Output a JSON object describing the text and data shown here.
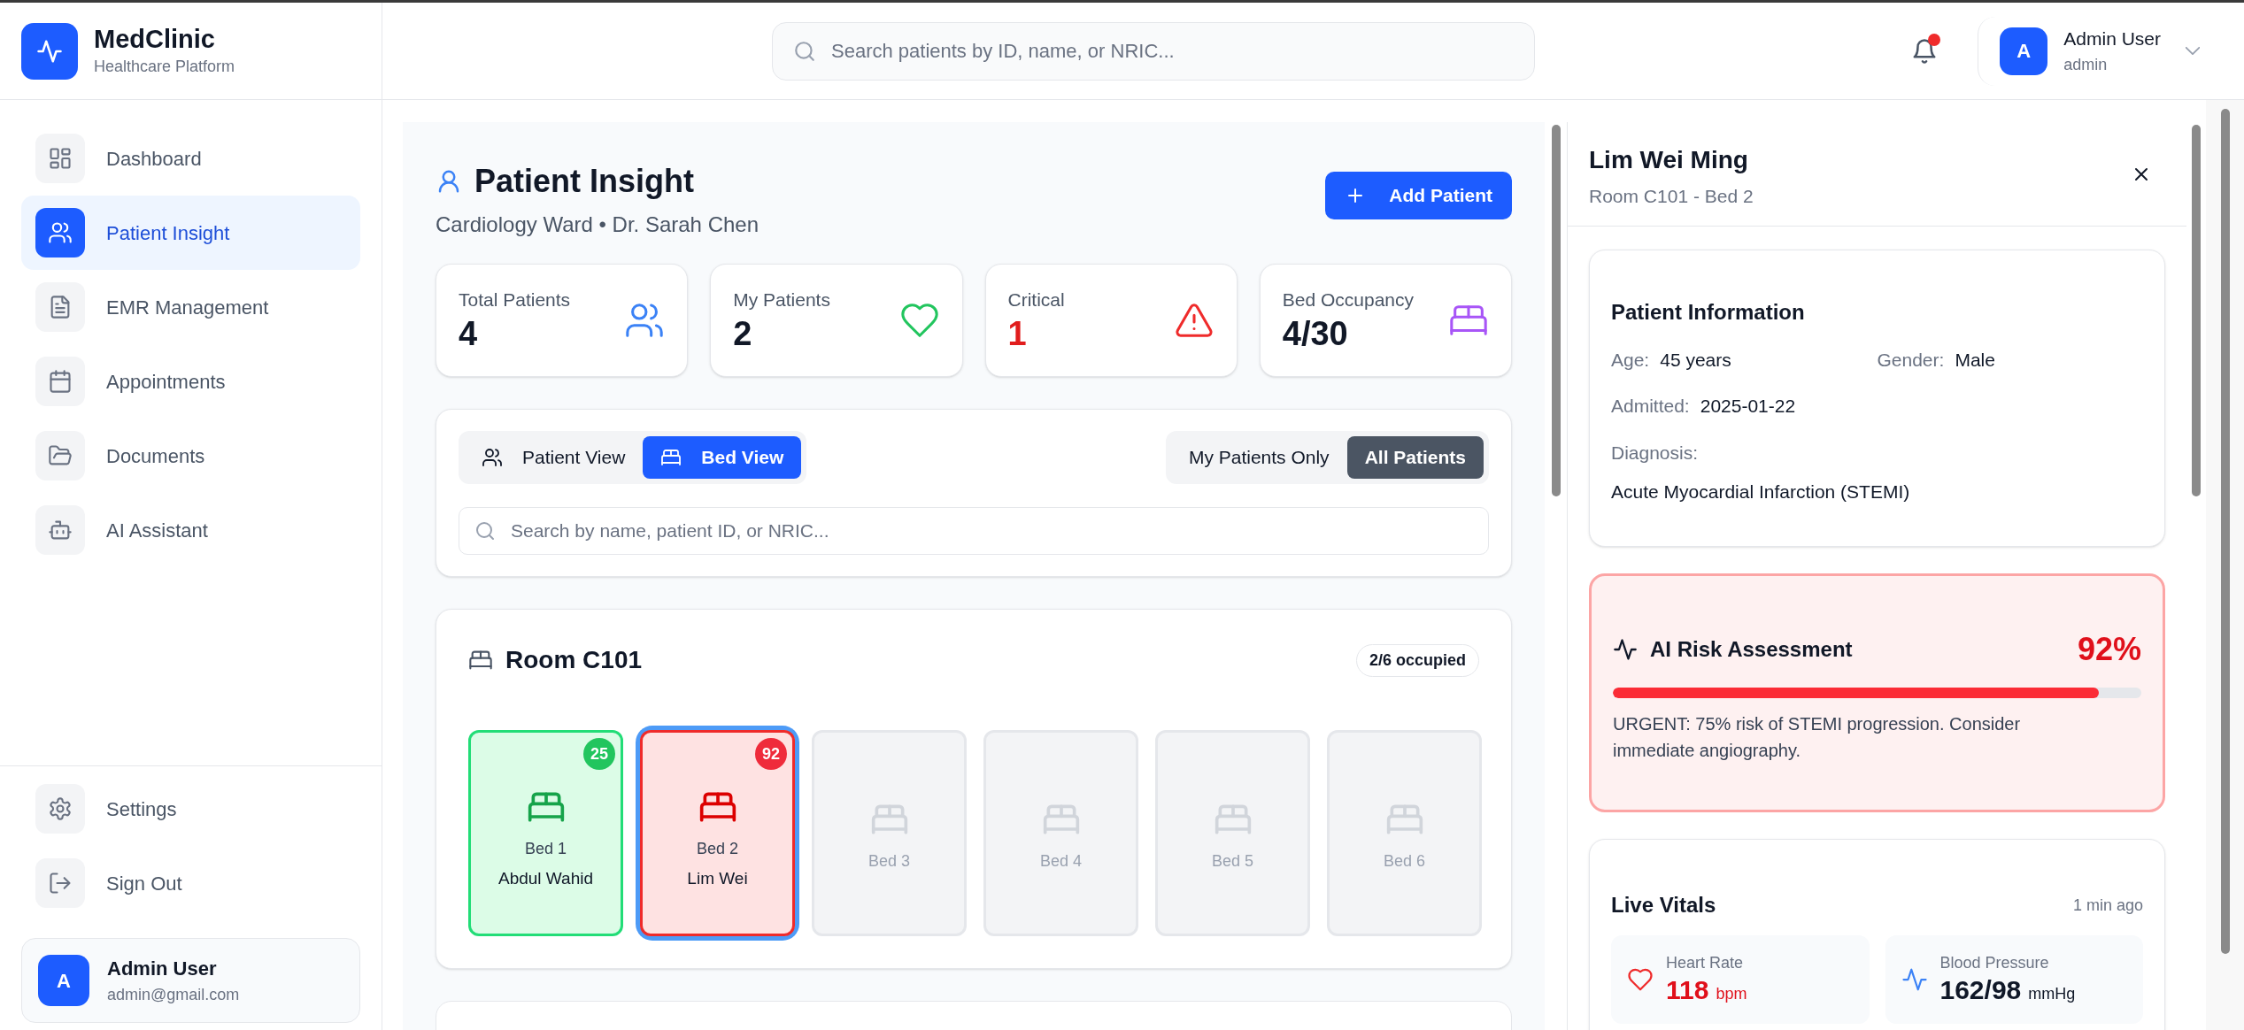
{
  "app": {
    "name": "MedClinic",
    "tagline": "Healthcare Platform"
  },
  "nav": [
    {
      "label": "Dashboard",
      "selected": false
    },
    {
      "label": "Patient Insight",
      "selected": true
    },
    {
      "label": "EMR Management",
      "selected": false
    },
    {
      "label": "Appointments",
      "selected": false
    },
    {
      "label": "Documents",
      "selected": false
    },
    {
      "label": "AI Assistant",
      "selected": false
    }
  ],
  "nav_bottom": [
    {
      "label": "Settings"
    },
    {
      "label": "Sign Out"
    }
  ],
  "sidebar_user": {
    "initial": "A",
    "name": "Admin User",
    "email": "admin@gmail.com"
  },
  "header": {
    "search_placeholder": "Search patients by ID, name, or NRIC...",
    "notification_unread": true,
    "user": {
      "initial": "A",
      "name": "Admin User",
      "role": "admin"
    }
  },
  "page": {
    "title": "Patient Insight",
    "subtitle": "Cardiology Ward • Dr. Sarah Chen",
    "add_button": "Add Patient"
  },
  "stats": [
    {
      "label": "Total Patients",
      "value": "4",
      "kind": "total"
    },
    {
      "label": "My Patients",
      "value": "2",
      "kind": "mine"
    },
    {
      "label": "Critical",
      "value": "1",
      "kind": "critical"
    },
    {
      "label": "Bed Occupancy",
      "value": "4/30",
      "kind": "beds"
    }
  ],
  "view_tabs": [
    {
      "label": "Patient View",
      "selected": false
    },
    {
      "label": "Bed View",
      "selected": true
    }
  ],
  "filter_tabs": [
    {
      "label": "My Patients Only",
      "selected": false
    },
    {
      "label": "All Patients",
      "selected": true
    }
  ],
  "list_search": {
    "placeholder": "Search by name, patient ID, or NRIC..."
  },
  "rooms": [
    {
      "name": "Room C101",
      "occupancy": "2/6 occupied",
      "beds": [
        {
          "label": "Bed 1",
          "patient": "Abdul Wahid",
          "score": "25",
          "kind": "stable",
          "selected": false
        },
        {
          "label": "Bed 2",
          "patient": "Lim Wei",
          "score": "92",
          "kind": "critical",
          "selected": true
        },
        {
          "label": "Bed 3",
          "kind": "empty",
          "selected": false
        },
        {
          "label": "Bed 4",
          "kind": "empty",
          "selected": false
        },
        {
          "label": "Bed 5",
          "kind": "empty",
          "selected": false
        },
        {
          "label": "Bed 6",
          "kind": "empty",
          "selected": false
        }
      ]
    }
  ],
  "detail": {
    "name": "Lim Wei Ming",
    "location": "Room C101 - Bed 2",
    "info": {
      "title": "Patient Information",
      "fields": [
        {
          "label": "Age:",
          "value": "45 years"
        },
        {
          "label": "Gender:",
          "value": "Male"
        },
        {
          "label": "Admitted:",
          "value": "2025-01-22"
        }
      ],
      "diagnosis_label": "Diagnosis:",
      "diagnosis": "Acute Myocardial Infarction (STEMI)"
    },
    "risk": {
      "title": "AI Risk Assessment",
      "score": "92%",
      "level": 0.92,
      "note": "URGENT: 75% risk of STEMI progression. Consider immediate angiography."
    },
    "vitals": {
      "title": "Live Vitals",
      "updated": "1 min ago",
      "items": [
        {
          "label": "Heart Rate",
          "value": "118",
          "unit": "bpm",
          "kind": "heart",
          "alert": true
        },
        {
          "label": "Blood Pressure",
          "value": "162/98",
          "unit": "mmHg",
          "kind": "pulse",
          "alert": false
        }
      ]
    }
  }
}
